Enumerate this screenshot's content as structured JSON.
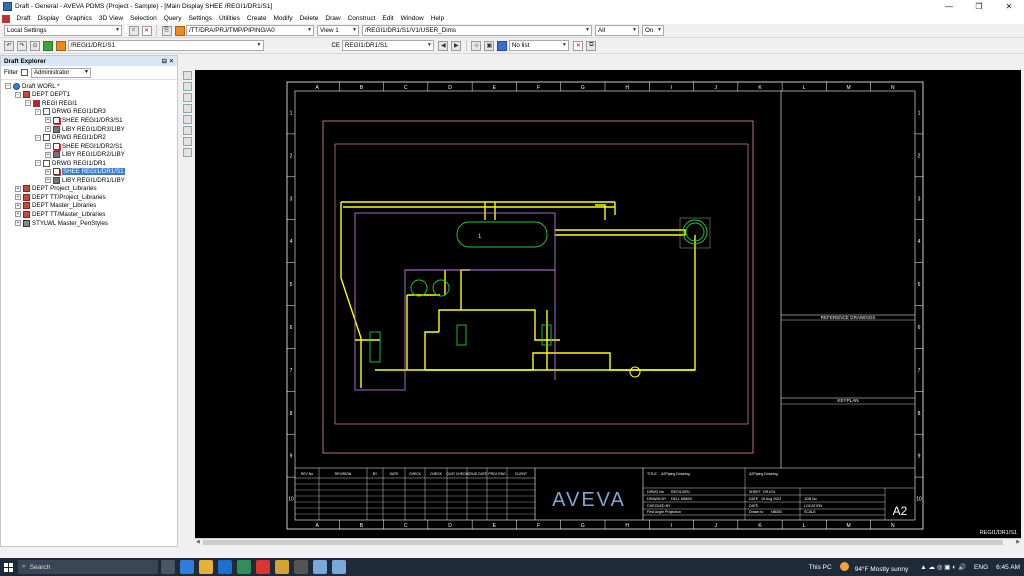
{
  "window": {
    "title": "Draft - General - AVEVA PDMS (Project - Sample) - [Main Display  SHEE  /REGI1/DR1/S1]",
    "minimize": "—",
    "maximize": "❐",
    "close": "✕"
  },
  "menubar": [
    "Draft",
    "Display",
    "Graphics",
    "3D View",
    "Selection",
    "Query",
    "Settings",
    "Utilities",
    "Create",
    "Modify",
    "Delete",
    "Draw",
    "Construct",
    "Edit",
    "Window",
    "Help"
  ],
  "toolbar1": {
    "settings_combo": "Local Settings",
    "blank_combo": "",
    "path_combo": "/TT/DRA/PRJ/TMP/PIPING/A0",
    "view_combo": "View 1",
    "dims_combo": "/REGI1/DR1/S1/V1/USER_Dims",
    "all_combo": "All",
    "on_combo": "On"
  },
  "toolbar2": {
    "current_combo": "/REGI1/DR1/S1",
    "ce_label": "CE",
    "ce_combo": "REGI1/DR1/S1",
    "list_combo": "No list"
  },
  "explorer": {
    "title": "Draft Explorer",
    "pin": "⊟ ✕",
    "filter_label": "Filter",
    "filter_value": "Administrator",
    "tree": [
      {
        "indent": 0,
        "toggle": "−",
        "icon": "world",
        "label": "Draft WORL *"
      },
      {
        "indent": 1,
        "toggle": "−",
        "icon": "dept",
        "label": "DEPT DEPT1"
      },
      {
        "indent": 2,
        "toggle": "−",
        "icon": "regi",
        "label": "REGI REGI1"
      },
      {
        "indent": 3,
        "toggle": "−",
        "icon": "drwg",
        "label": "DRWG REGI1/DR3"
      },
      {
        "indent": 4,
        "toggle": "+",
        "icon": "shee",
        "label": "SHEE REGI1/DR3/S1"
      },
      {
        "indent": 4,
        "toggle": "+",
        "icon": "liby",
        "label": "LIBY REGI1/DR3/LIBY"
      },
      {
        "indent": 3,
        "toggle": "−",
        "icon": "drwg",
        "label": "DRWG REGI1/DR2"
      },
      {
        "indent": 4,
        "toggle": "+",
        "icon": "shee",
        "label": "SHEE REGI1/DR2/S1"
      },
      {
        "indent": 4,
        "toggle": "+",
        "icon": "liby",
        "label": "LIBY REGI1/DR2/LIBY"
      },
      {
        "indent": 3,
        "toggle": "−",
        "icon": "drwg",
        "label": "DRWG REGI1/DR1"
      },
      {
        "indent": 4,
        "toggle": "+",
        "icon": "shee",
        "label": "SHEE REGI1/DR1/S1",
        "selected": true
      },
      {
        "indent": 4,
        "toggle": "+",
        "icon": "liby",
        "label": "LIBY REGI1/DR1/LIBY"
      },
      {
        "indent": 1,
        "toggle": "+",
        "icon": "dept",
        "label": "DEPT Project_Libraries"
      },
      {
        "indent": 1,
        "toggle": "+",
        "icon": "dept",
        "label": "DEPT TT/Project_Libraries"
      },
      {
        "indent": 1,
        "toggle": "+",
        "icon": "dept",
        "label": "DEPT Master_Libraries"
      },
      {
        "indent": 1,
        "toggle": "+",
        "icon": "dept",
        "label": "DEPT TT/Master_Libraries"
      },
      {
        "indent": 1,
        "toggle": "+",
        "icon": "styl",
        "label": "STYLWL Master_PenStyles"
      }
    ]
  },
  "drawing": {
    "col_labels": [
      "A",
      "B",
      "C",
      "D",
      "E",
      "F",
      "G",
      "H",
      "I",
      "J",
      "K",
      "L",
      "M",
      "N"
    ],
    "row_labels": [
      "1",
      "2",
      "3",
      "4",
      "5",
      "6",
      "7",
      "8",
      "9",
      "10"
    ],
    "reference_drawings": "REFERENCE DRAWINGS",
    "keyplan": "KEYPLAN",
    "revision_headers": [
      "REV No",
      "REVISION",
      "BY",
      "DATE",
      "CHECK",
      "CHECK",
      "CLNT CHECK",
      "ISSUE DATE",
      "PROJ ENG",
      "CLIENT"
    ],
    "logo": "AVEVA",
    "title_label": "TITLE",
    "title_value": "A2Piping Drawing",
    "title_value2": "A2Piping Drawing",
    "drwg_no_label": "DRWG No",
    "drwg_no_value": "REGI1/DR1",
    "sheet_label": "SHEET",
    "sheet_value": "DR1/S1",
    "drawn_by_label": "DRAWN BY",
    "drawn_by_value": "DELL M6600",
    "date_label": "DATE",
    "date_value": "15 Aug 2023",
    "job_label": "JOB No",
    "checked_label": "CHECKED BY",
    "date2_label": "DATE",
    "location_label": "LOCATION",
    "projection": "First Angle Projection",
    "drawn_to_label": "Drawn to",
    "drawn_to_value": "NB300",
    "scale_label": "SCALE",
    "sheet_size": "A2",
    "sheet_ref": "REGI1/DR1/S1",
    "equip_label": "1"
  },
  "taskbar": {
    "search": "Search",
    "this_pc": "This PC",
    "weather": "94°F  Mostly sunny",
    "lang": "ENG",
    "time": "6:45 AM"
  },
  "colors": {
    "pipe": "#ffff00",
    "border": "#ffffff",
    "frame": "#ff9fd0",
    "equipment": "#22cc33",
    "canvas": "#000000",
    "selection": "#3b7bd6"
  }
}
